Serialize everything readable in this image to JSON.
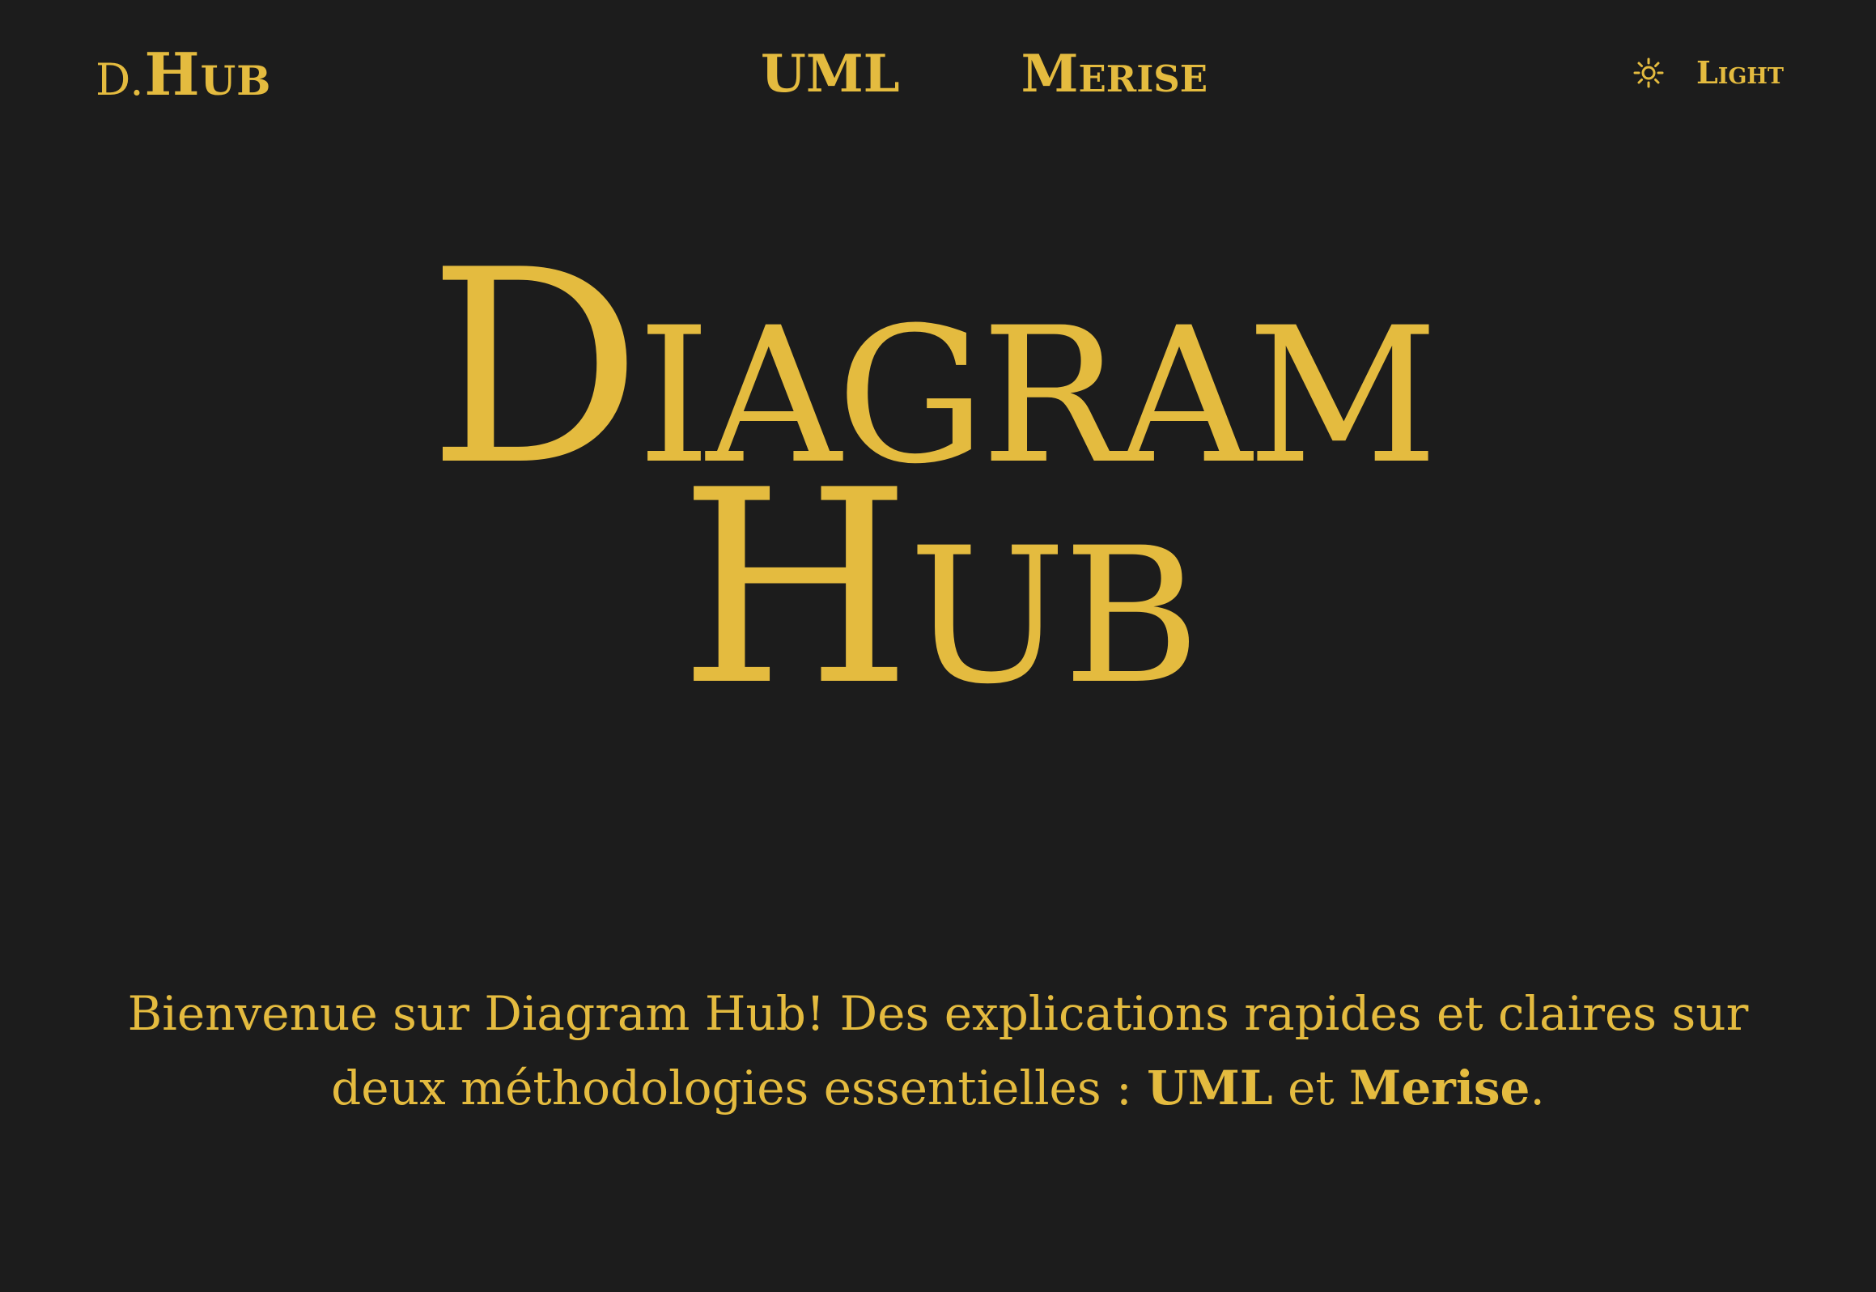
{
  "header": {
    "logo_prefix": "D.",
    "logo_main": "Hub",
    "nav": [
      {
        "label": "UML"
      },
      {
        "label": "Merise"
      }
    ],
    "theme_toggle": {
      "icon": "sun-icon",
      "label": "Light"
    }
  },
  "hero": {
    "line1": "Diagram",
    "line2": "Hub"
  },
  "intro": {
    "text_before": "Bienvenue sur Diagram Hub! Des explications rapides et claires sur deux méthodologies essentielles : ",
    "bold1": "UML",
    "middle": " et ",
    "bold2": "Merise",
    "end": "."
  },
  "colors": {
    "background": "#1c1c1c",
    "accent": "#e4bb3f"
  }
}
